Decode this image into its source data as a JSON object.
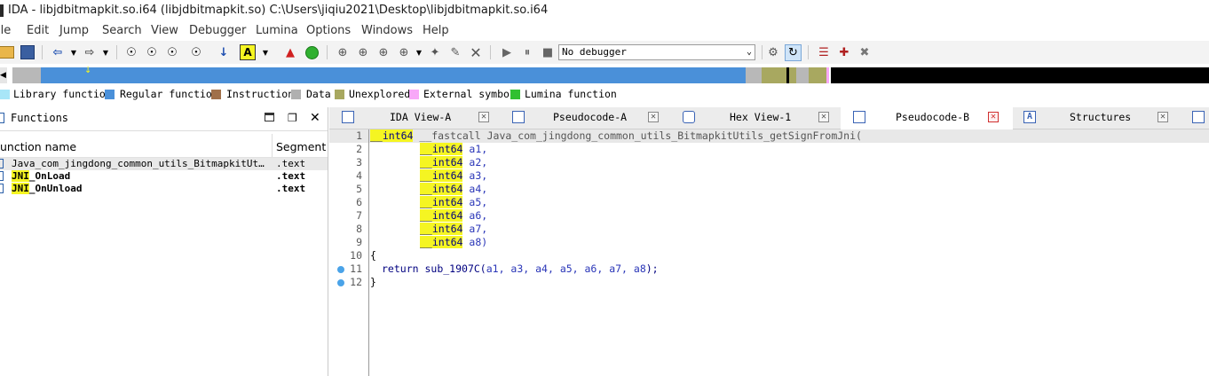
{
  "window": {
    "title": "IDA - libjdbitmapkit.so.i64 (libjdbitmapkit.so) C:\\Users\\jiqiu2021\\Desktop\\libjdbitmapkit.so.i64"
  },
  "menu": [
    "ile",
    "Edit",
    "Jump",
    "Search",
    "View",
    "Debugger",
    "Lumina",
    "Options",
    "Windows",
    "Help"
  ],
  "toolbar": {
    "debugger_value": "No debugger"
  },
  "legend": [
    {
      "label": "Library function",
      "color": "#a8e6f8"
    },
    {
      "label": "Regular function",
      "color": "#4a90d9"
    },
    {
      "label": "Instruction",
      "color": "#a0704a"
    },
    {
      "label": "Data",
      "color": "#b0b0b0"
    },
    {
      "label": "Unexplored",
      "color": "#a8a860"
    },
    {
      "label": "External symbol",
      "color": "#f8a8f8"
    },
    {
      "label": "Lumina function",
      "color": "#30c030"
    }
  ],
  "functions_panel": {
    "title": "Functions",
    "col_name": "unction name",
    "col_segment": "Segment",
    "rows": [
      {
        "name": "Java_com_jingdong_common_utils_BitmapkitUtils_…",
        "segment": ".text"
      },
      {
        "name_hl": "JNI",
        "name_rest": "_OnLoad",
        "segment": ".text"
      },
      {
        "name_hl": "JNI",
        "name_rest": "_OnUnload",
        "segment": ".text"
      }
    ]
  },
  "tabs": [
    {
      "label": "IDA View-A"
    },
    {
      "label": "Pseudocode-A"
    },
    {
      "label": "Hex View-1"
    },
    {
      "label": "Pseudocode-B"
    },
    {
      "label": "Structures"
    }
  ],
  "code": {
    "line_numbers": [
      "1",
      "2",
      "3",
      "4",
      "5",
      "6",
      "7",
      "8",
      "9",
      "10",
      "11",
      "12"
    ],
    "type": "__int64",
    "call_conv": "__fastcall",
    "func_name": "Java_com_jingdong_common_utils_BitmapkitUtils_getSignFromJni(",
    "params": [
      "a1,",
      "a2,",
      "a3,",
      "a4,",
      "a5,",
      "a6,",
      "a7,",
      "a8)"
    ],
    "open_brace": "{",
    "return_kw": "return",
    "callee": "sub_1907C",
    "args": "a1, a3, a4, a5, a6, a7, a8",
    "close_brace": "}"
  }
}
